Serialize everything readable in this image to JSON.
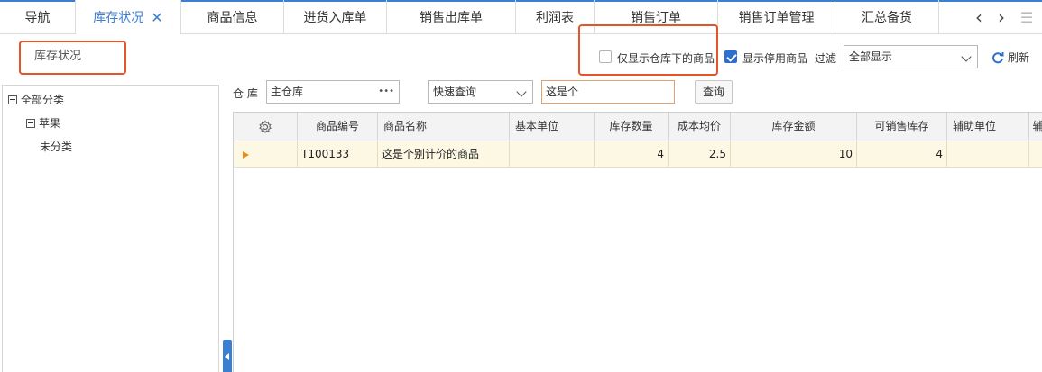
{
  "tabs": [
    {
      "label": "导航",
      "active": false
    },
    {
      "label": "库存状况",
      "active": true,
      "closable": true
    },
    {
      "label": "商品信息",
      "active": false
    },
    {
      "label": "进货入库单",
      "active": false
    },
    {
      "label": "销售出库单",
      "active": false
    },
    {
      "label": "利润表",
      "active": false
    },
    {
      "label": "销售订单",
      "active": false
    },
    {
      "label": "销售订单管理",
      "active": false
    },
    {
      "label": "汇总备货",
      "active": false
    }
  ],
  "tab_close_glyph": "✕",
  "tab_nav": {
    "prev": "‹",
    "next": "›",
    "menu": "☰"
  },
  "page_title": "库存状况",
  "filters": {
    "only_warehouse_label": "仅显示仓库下的商品",
    "only_warehouse_checked": false,
    "show_disabled_label": "显示停用商品",
    "show_disabled_checked": true,
    "filter_label": "过滤",
    "filter_value": "全部显示",
    "refresh_label": "刷新"
  },
  "tree": {
    "root": "全部分类",
    "child": "苹果",
    "grandchild": "未分类"
  },
  "search": {
    "warehouse_label": "仓 库",
    "warehouse_value": "主仓库",
    "warehouse_more": "•••",
    "mode_value": "快速查询",
    "query_value": "这是个",
    "query_button": "查询"
  },
  "grid": {
    "columns": [
      "商品编号",
      "商品名称",
      "基本单位",
      "库存数量",
      "成本均价",
      "库存金额",
      "可销售库存",
      "辅助单位",
      "辅"
    ],
    "rows": [
      {
        "code": "T100133",
        "name": "这是个别计价的商品",
        "unit": "",
        "qty": "4",
        "avg_cost": "2.5",
        "amount": "10",
        "saleable": "4",
        "aux_unit": "",
        "extra": ""
      }
    ]
  },
  "colors": {
    "accent": "#3a80d2",
    "highlight": "#e8542a",
    "row_selected": "#fdf8e4"
  },
  "icons": [
    "close-icon",
    "chevron-left-icon",
    "chevron-right-icon",
    "menu-icon",
    "checkbox-icon",
    "caret-down-icon",
    "refresh-icon",
    "minus-box-icon",
    "gear-icon",
    "row-pointer-icon",
    "collapse-arrow-icon"
  ]
}
